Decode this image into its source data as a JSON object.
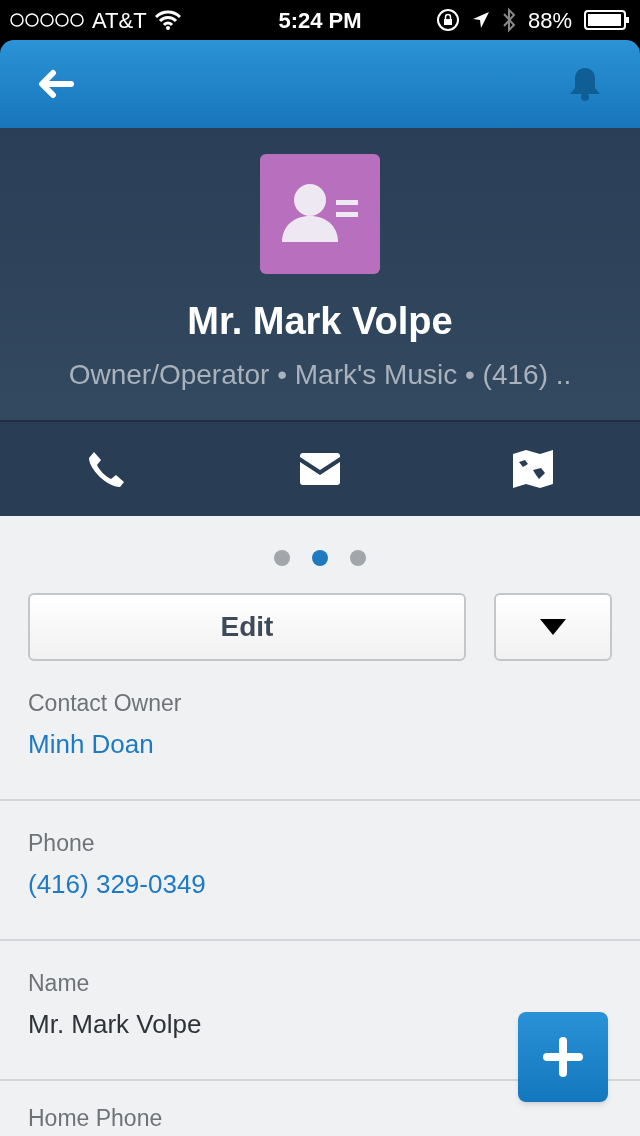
{
  "status_bar": {
    "carrier": "AT&T",
    "time": "5:24 PM",
    "battery": "88%"
  },
  "profile": {
    "name": "Mr. Mark Volpe",
    "subtitle": "Owner/Operator • Mark's Music • (416) .."
  },
  "pager": [
    {
      "selected": false
    },
    {
      "selected": true
    },
    {
      "selected": false
    }
  ],
  "edit_button": "Edit",
  "fields": [
    {
      "label": "Contact Owner",
      "value": "Minh Doan",
      "kind": "link"
    },
    {
      "label": "Phone",
      "value": "(416) 329-0349",
      "kind": "link"
    },
    {
      "label": "Name",
      "value": "Mr. Mark Volpe",
      "kind": "text"
    },
    {
      "label": "Home Phone",
      "kind": "text"
    }
  ]
}
